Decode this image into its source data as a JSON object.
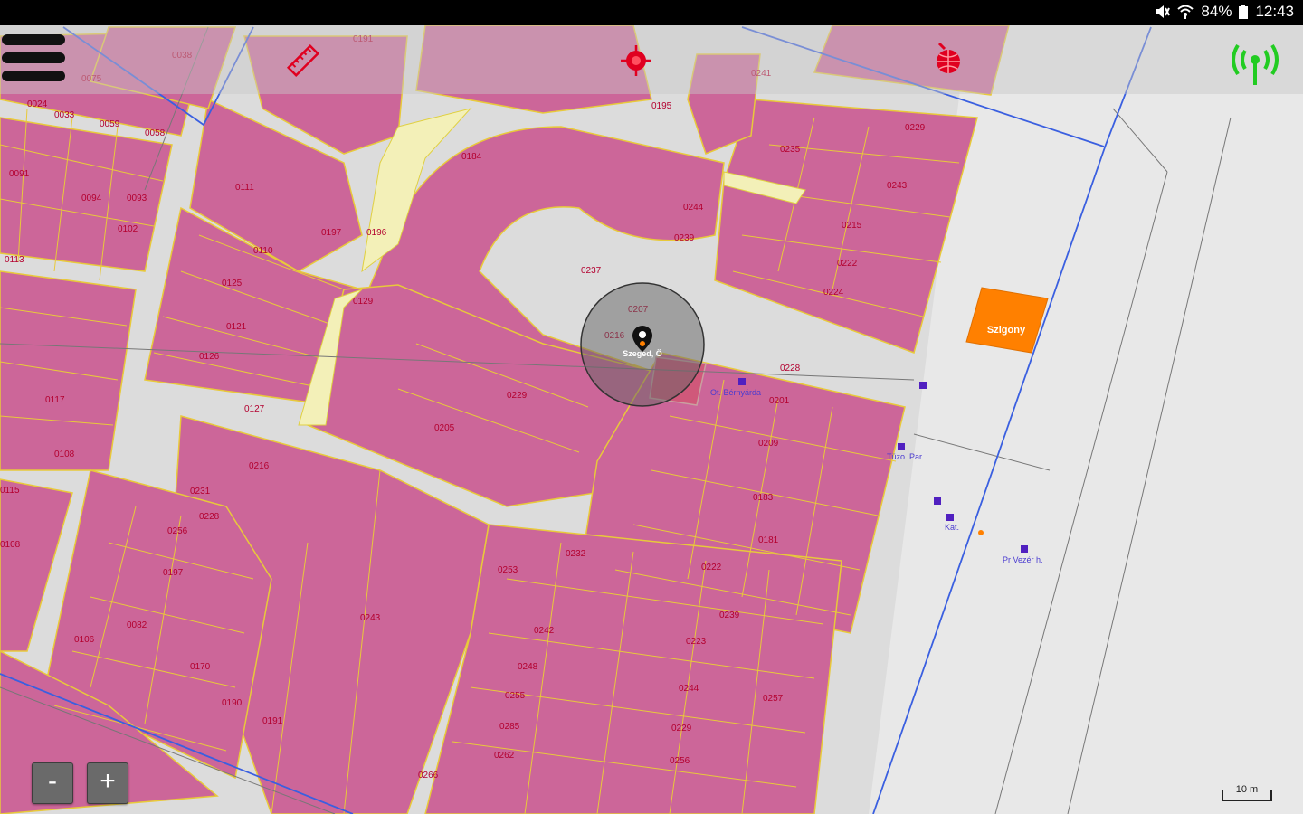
{
  "status_bar": {
    "battery": "84%",
    "time": "12:43",
    "icons": [
      "mute-icon",
      "wifi-icon",
      "battery-icon"
    ]
  },
  "toolbar": {
    "menu_icon": "hamburger-menu-icon",
    "measure_icon": "ruler-icon",
    "locate_icon": "crosshair-target-icon",
    "web_icon": "globe-icon",
    "signal_icon": "gps-signal-icon"
  },
  "map": {
    "colors": {
      "parcel_fill": "#cc6699",
      "parcel_stroke": "#e8c93a",
      "road": "#e6e6e6",
      "boundary_blue": "#3a5fe0",
      "orange_building": "#ff8000"
    },
    "building_label": "Szigony",
    "poi_labels": [
      "Ot. Bérnyárda",
      "Tüzo. Par.",
      "Kat.",
      "Pr Vezér h."
    ],
    "parcel_labels": [
      "0075",
      "0038",
      "0024",
      "0033",
      "0059",
      "0058",
      "0091",
      "0094",
      "0093",
      "0102",
      "0113",
      "0117",
      "0108",
      "0115",
      "0108",
      "0111",
      "0110",
      "0125",
      "0121",
      "0126",
      "0127",
      "0129",
      "0197",
      "0196",
      "0184",
      "0191",
      "0195",
      "0241",
      "0235",
      "0243",
      "0244",
      "0239",
      "0237",
      "0207",
      "0216",
      "0228",
      "0215",
      "0222",
      "0224",
      "0229",
      "0229",
      "0205",
      "0201",
      "0209",
      "0183",
      "0181",
      "0216",
      "0231",
      "0228",
      "0256",
      "0197",
      "0232",
      "0253",
      "0222",
      "0239",
      "0242",
      "0223",
      "0243",
      "0248",
      "0244",
      "0255",
      "0257",
      "0285",
      "0229",
      "0082",
      "0106",
      "0170",
      "0190",
      "0191",
      "0262",
      "0256",
      "0266"
    ],
    "current_location_label": "Szeged, Ö"
  },
  "controls": {
    "zoom_out": "-",
    "zoom_in": "+",
    "scale_label": "10 m"
  }
}
